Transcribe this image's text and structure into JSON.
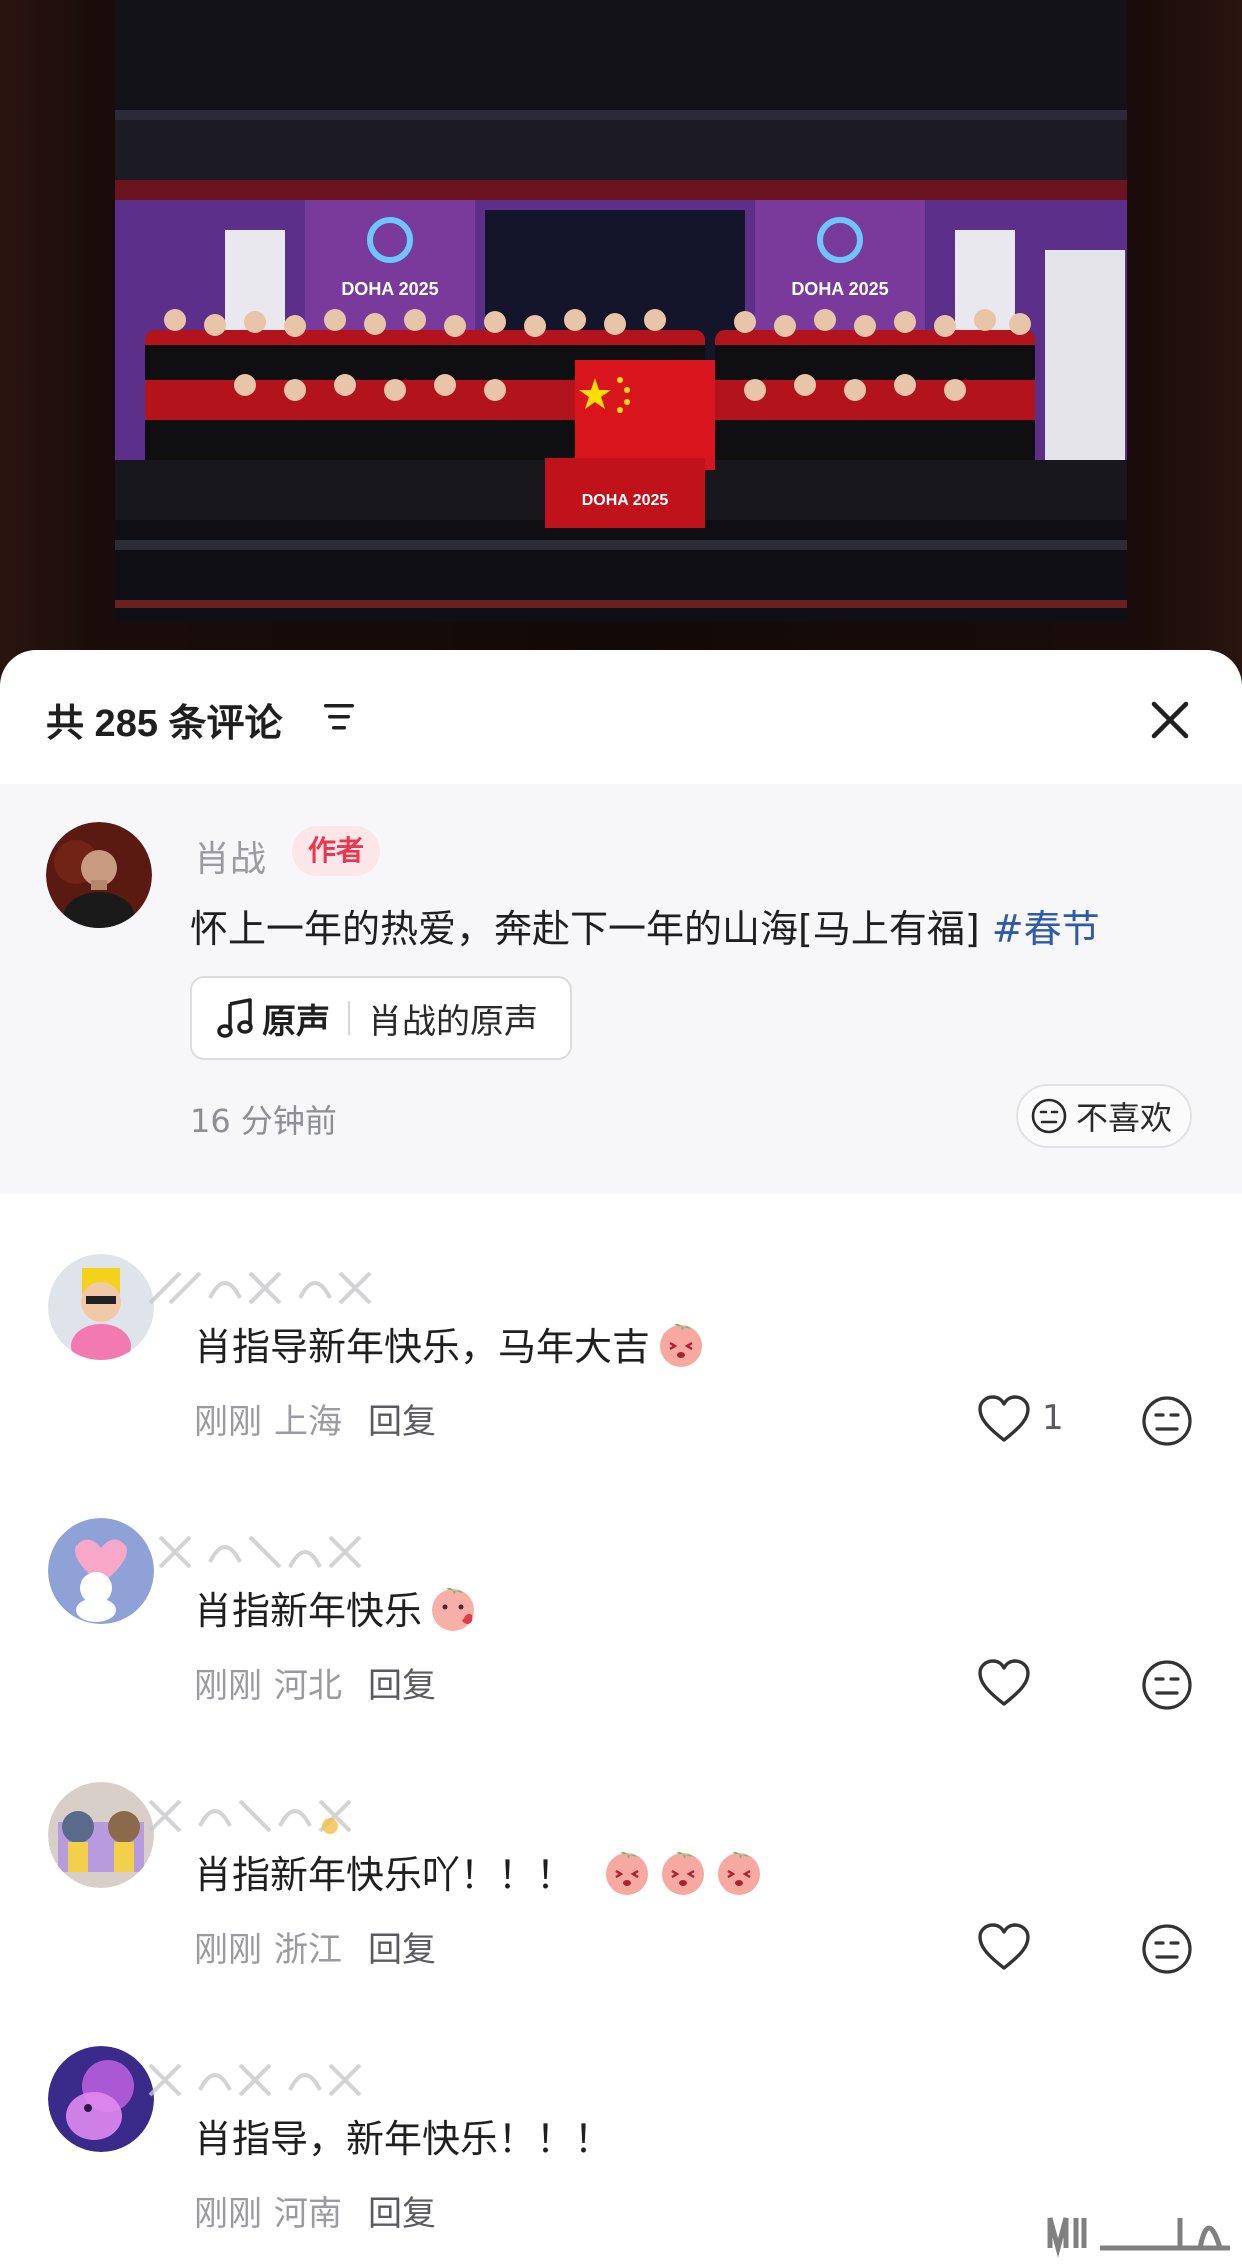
{
  "header": {
    "comment_count_title": "共 285 条评论"
  },
  "author_comment": {
    "name": "肖战",
    "badge": "作者",
    "text": "怀上一年的热爱，奔赴下一年的山海[马上有福] ",
    "hashtag": "#春节",
    "music_label_strong": "原声",
    "music_label": "肖战的原声",
    "time": "16 分钟前",
    "dislike_label": "不喜欢"
  },
  "photo": {
    "banner_left": "DOHA 2025",
    "banner_right": "DOHA 2025",
    "podium_text": "DOHA 2025"
  },
  "comments": [
    {
      "text": "肖指导新年快乐，马年大吉",
      "time": "刚刚",
      "location": "上海",
      "reply": "回复",
      "likes": "1",
      "emojis": 1
    },
    {
      "text": "肖指新年快乐",
      "time": "刚刚",
      "location": "河北",
      "reply": "回复",
      "likes": "",
      "emojis": 1
    },
    {
      "text": "肖指新年快乐吖！！！",
      "time": "刚刚",
      "location": "浙江",
      "reply": "回复",
      "likes": "",
      "emojis": 3
    },
    {
      "text": "肖指导，新年快乐！！！",
      "time": "刚刚",
      "location": "河南",
      "reply": "回复",
      "likes": "",
      "emojis": 0
    }
  ],
  "colors": {
    "accent_red": "#e8384f",
    "hashtag_blue": "#2f5aa8",
    "author_card_bg": "#f7f7f9"
  }
}
